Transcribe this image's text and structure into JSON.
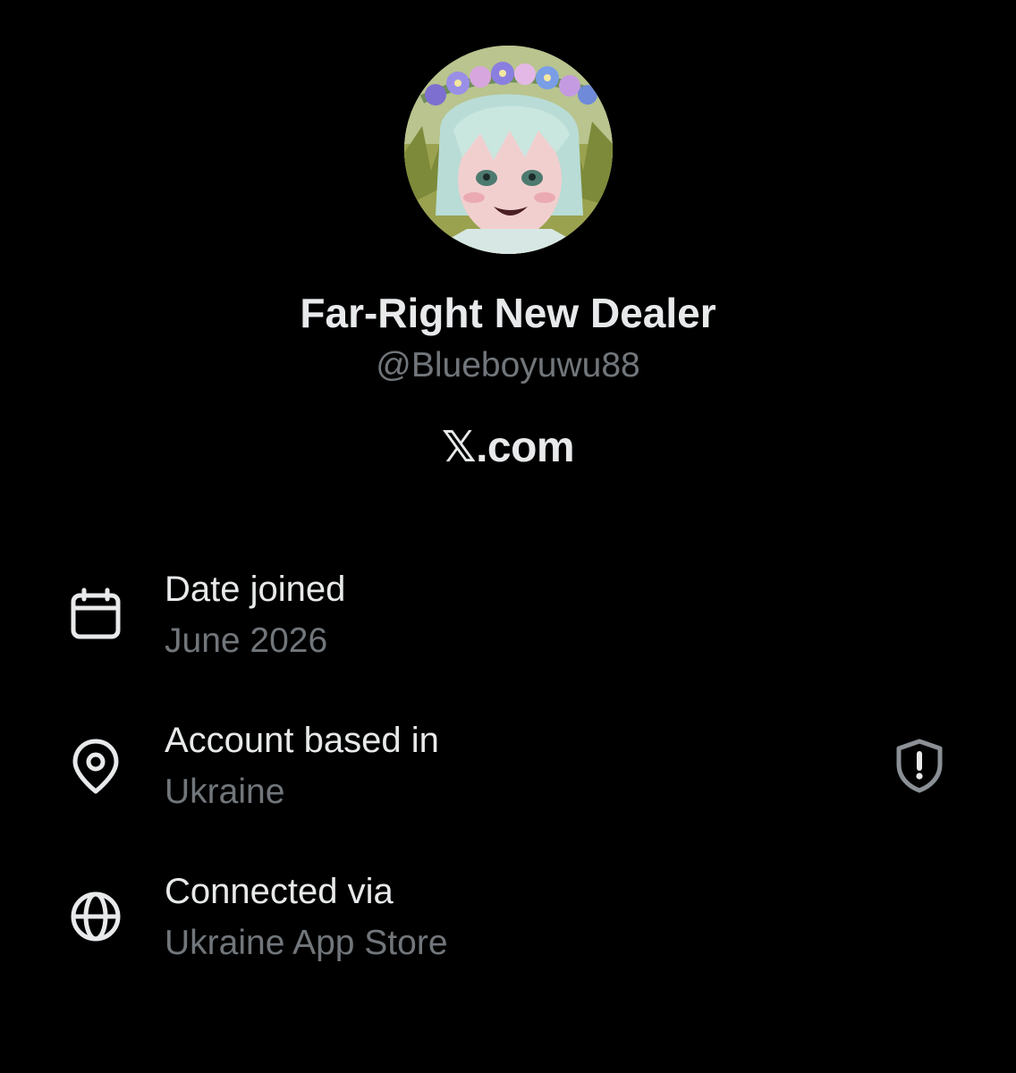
{
  "profile": {
    "display_name": "Far-Right New Dealer",
    "handle": "@Blueboyuwu88",
    "site": "𝕏.com"
  },
  "details": {
    "date_joined": {
      "label": "Date joined",
      "value": "June 2026",
      "icon": "calendar-icon"
    },
    "account_based_in": {
      "label": "Account based in",
      "value": "Ukraine",
      "icon": "location-pin-icon",
      "trailing_icon": "shield-alert-icon"
    },
    "connected_via": {
      "label": "Connected via",
      "value": "Ukraine App Store",
      "icon": "globe-icon"
    }
  },
  "colors": {
    "background": "#000000",
    "primary_text": "#e7e9ea",
    "secondary_text": "#71767b"
  }
}
